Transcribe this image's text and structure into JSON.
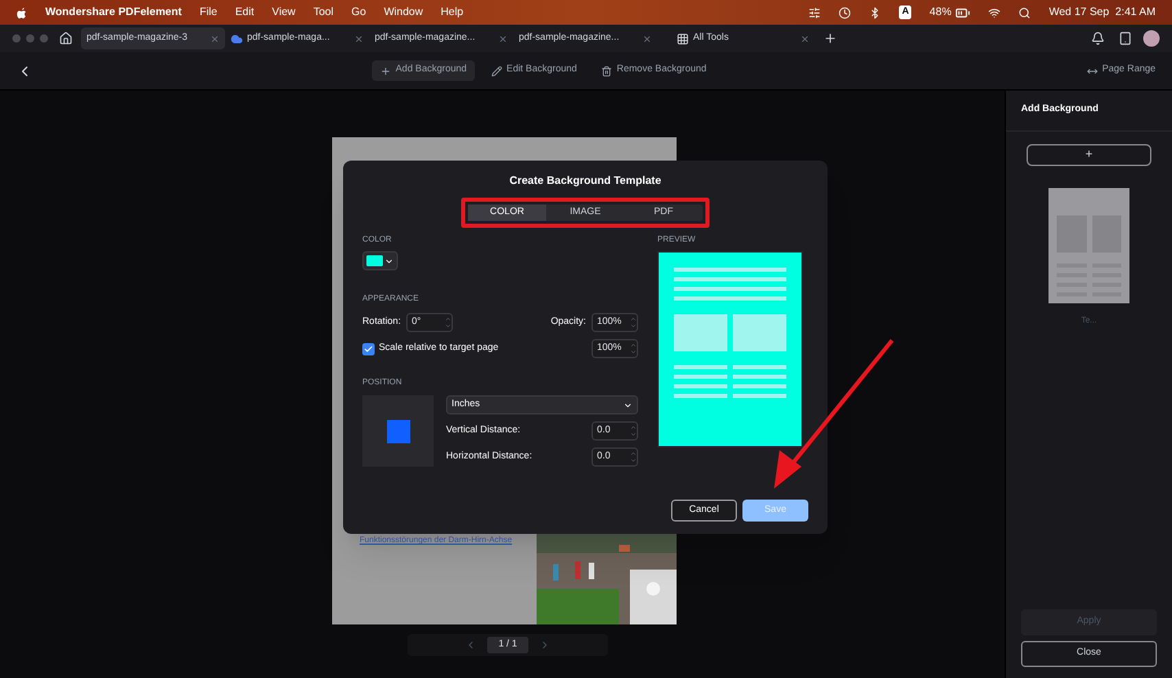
{
  "menubar": {
    "app_name": "Wondershare PDFelement",
    "menus": [
      "File",
      "Edit",
      "View",
      "Tool",
      "Go",
      "Window",
      "Help"
    ],
    "input_source": "A",
    "battery": "48%",
    "datetime": "Wed 17 Sep  2:41 AM"
  },
  "tabs": [
    {
      "label": "pdf-sample-magazine-3",
      "kind": "document",
      "selected": true
    },
    {
      "label": "pdf-sample-maga...",
      "kind": "cloud",
      "selected": false
    },
    {
      "label": "pdf-sample-magazine...",
      "kind": "document",
      "selected": false
    },
    {
      "label": "pdf-sample-magazine...",
      "kind": "document",
      "selected": false
    },
    {
      "label": "All Tools",
      "kind": "tools",
      "selected": false
    }
  ],
  "toolbar": {
    "actions": [
      {
        "label": "Add Background",
        "kind": "add",
        "selected": true
      },
      {
        "label": "Edit Background",
        "kind": "edit",
        "selected": false
      },
      {
        "label": "Remove Background",
        "kind": "remove",
        "selected": false
      }
    ],
    "page_range": "Page Range"
  },
  "document": {
    "link_text": "Funktionsstörungen der Darm-Hirn-Achse",
    "page_field": "1 / 1"
  },
  "dialog": {
    "title": "Create Background Template",
    "tabs": [
      {
        "label": "COLOR",
        "selected": true
      },
      {
        "label": "IMAGE",
        "selected": false
      },
      {
        "label": "PDF",
        "selected": false
      }
    ],
    "color_label": "COLOR",
    "appearance_label": "APPEARANCE",
    "rotation": {
      "label": "Rotation:",
      "value": "0°"
    },
    "opacity": {
      "label": "Opacity:",
      "value": "100%"
    },
    "scale": {
      "label": "Scale relative to target page",
      "checked": true,
      "value": "100%"
    },
    "position_label": "POSITION",
    "unit": "Inches",
    "vertical": {
      "label": "Vertical Distance:",
      "value": "0.0"
    },
    "horizontal": {
      "label": "Horizontal Distance:",
      "value": "0.0"
    },
    "preview_label": "PREVIEW",
    "cancel": "Cancel",
    "save": "Save"
  },
  "side_panel": {
    "title": "Add Background",
    "add_button": "+",
    "template_caption": "Te...",
    "apply": {
      "label": "Apply",
      "disabled": true
    },
    "close": "Close"
  }
}
